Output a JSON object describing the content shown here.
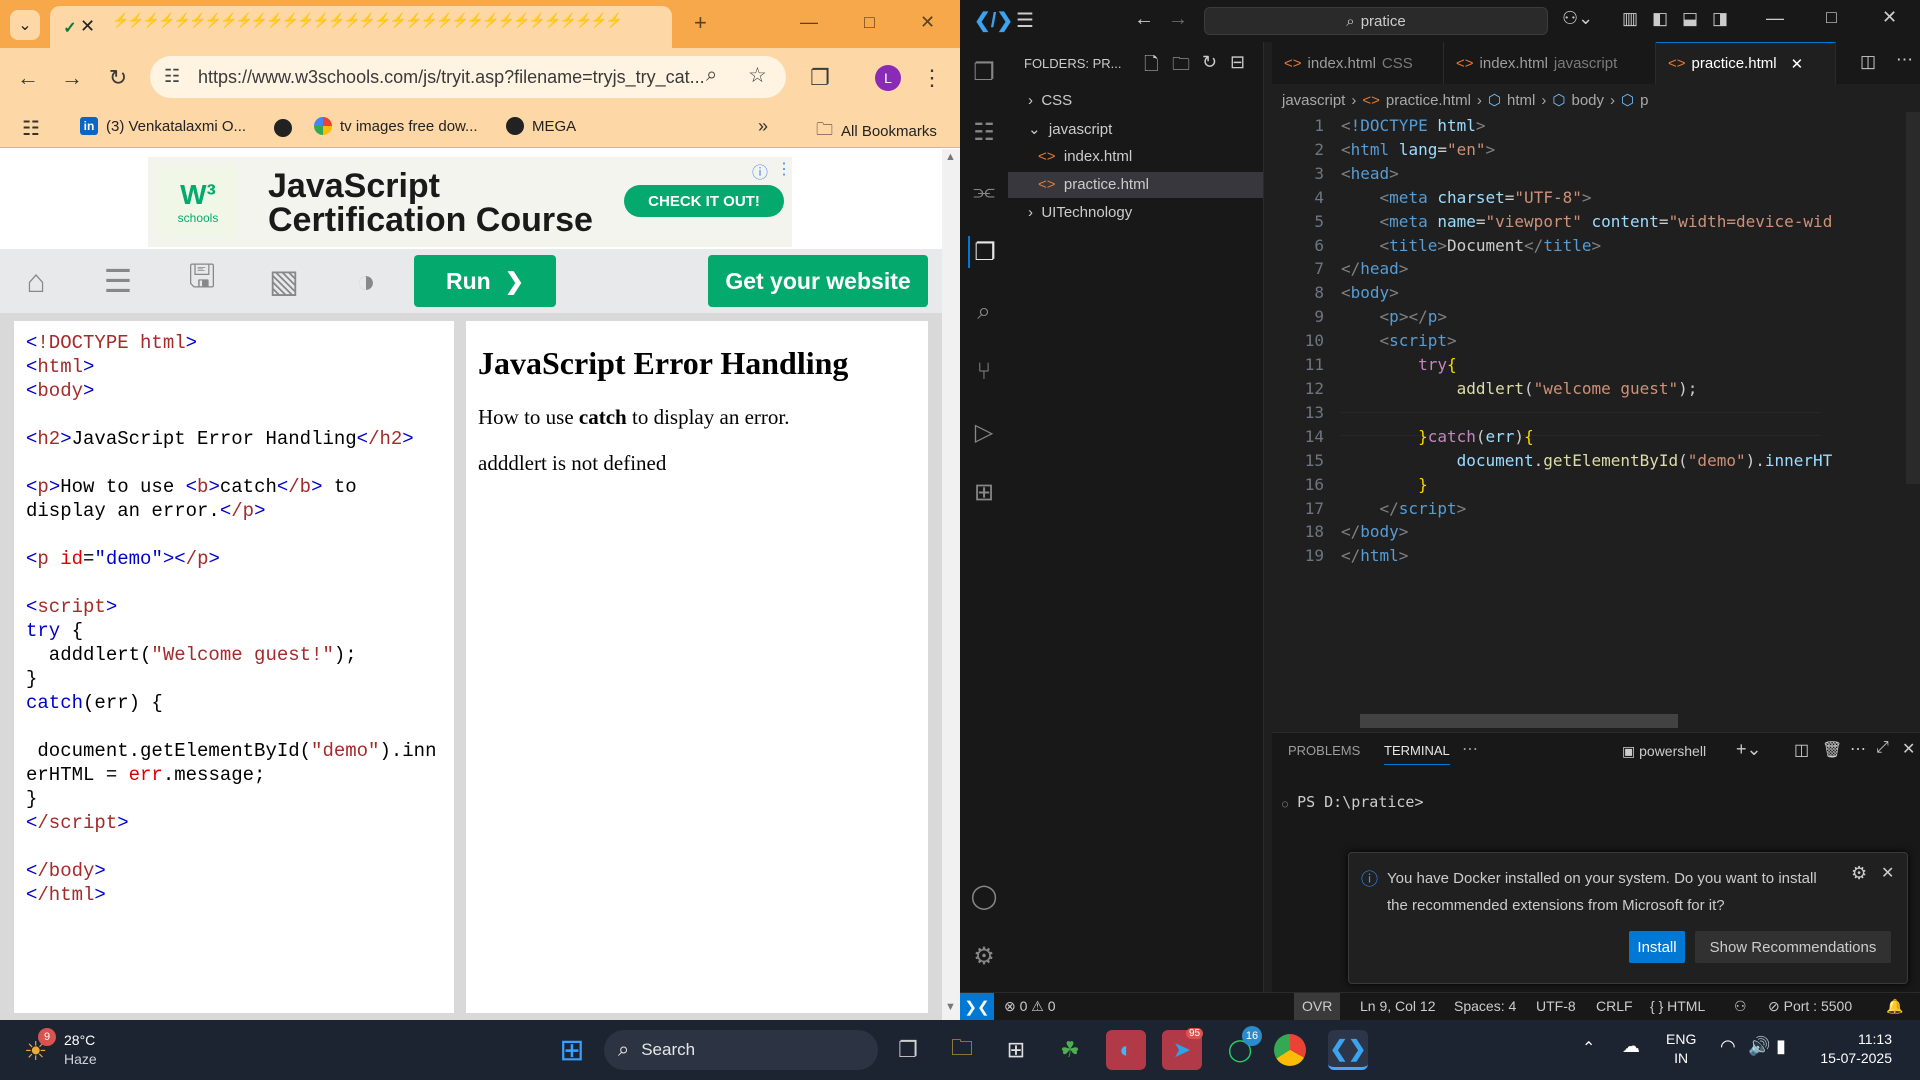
{
  "chrome": {
    "tab_title": "⚡⚡⚡⚡⚡⚡⚡⚡⚡⚡⚡⚡⚡⚡⚡⚡⚡⚡⚡⚡⚡⚡⚡⚡⚡⚡⚡⚡⚡⚡⚡⚡⚡",
    "url": "https://www.w3schools.com/js/tryit.asp?filename=tryjs_try_cat...",
    "profile_letter": "L",
    "bookmarks": [
      "(3) Venkatalaxmi O...",
      "tv images free dow...",
      "MEGA"
    ],
    "all_bookmarks": "All Bookmarks"
  },
  "w3": {
    "ad_logo_text": "W³",
    "ad_logo_sub": "schools",
    "ad_title": "JavaScript Certification Course",
    "ad_cta": "CHECK IT OUT!",
    "run_label": "Run",
    "get_website_label": "Get your website",
    "result_heading": "JavaScript Error Handling",
    "result_line1_pre": "How to use ",
    "result_line1_bold": "catch",
    "result_line1_post": " to display an error.",
    "result_error": "adddlert is not defined"
  },
  "vscode": {
    "search_text": "pratice",
    "explorer_header": "FOLDERS: PR...",
    "tree": [
      "CSS",
      "javascript",
      "index.html",
      "practice.html",
      "UITechnology"
    ],
    "tabs": [
      {
        "name": "index.html",
        "desc": "CSS"
      },
      {
        "name": "index.html",
        "desc": "javascript"
      },
      {
        "name": "practice.html",
        "desc": ""
      }
    ],
    "breadcrumb": [
      "javascript",
      "practice.html",
      "html",
      "body",
      "p"
    ],
    "line_numbers": "1\n2\n3\n4\n5\n6\n7\n8\n9\n10\n11\n12\n13\n14\n15\n16\n17\n18\n19",
    "panel_tabs": [
      "PROBLEMS",
      "TERMINAL"
    ],
    "terminal_shell": "powershell",
    "terminal_prompt": "PS D:\\pratice>",
    "notification_text": "You have Docker installed on your system. Do you want to install the recommended extensions from Microsoft for it?",
    "notification_install": "Install",
    "notification_show": "Show Recommendations",
    "status": {
      "problems": "⊗ 0 ⚠ 0",
      "ovr": "OVR",
      "position": "Ln 9, Col 12",
      "spaces": "Spaces: 4",
      "encoding": "UTF-8",
      "eol": "CRLF",
      "language": "{ } HTML",
      "port": "⊘ Port : 5500"
    }
  },
  "taskbar": {
    "weather_temp": "28°C",
    "weather_desc": "Haze",
    "weather_badge": "9",
    "search_label": "Search",
    "lang_line1": "ENG",
    "lang_line2": "IN",
    "time": "11:13",
    "date": "15-07-2025",
    "telegram_badge": "95",
    "whatsapp_badge": "16"
  }
}
